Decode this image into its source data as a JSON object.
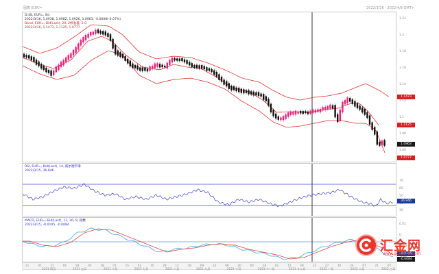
{
  "titlebar": {
    "left": "图表 EUR/=",
    "right": "2022/3/16 · 2022/4/8 GMT+"
  },
  "price": {
    "info1": "D:48, EUR=, Bd",
    "info2": "2022/3/16, 1.0938, 1.0982, 1.0926, 1.0963, -0.0008(-0.07%)",
    "info3": "Band, EUR=, Bid(Last), 20, 2标准差, 2.0",
    "info4": "2022/3/16, 1.1473, 1.1125, 1.0777",
    "y_ticks": [
      "1.22",
      "1.2",
      "1.18",
      "1.16",
      "1.14",
      "1.12",
      "1.1",
      "1.08",
      "1.06"
    ],
    "tags": {
      "upper": "1.1473",
      "mid": "1.1125",
      "last": "1.0963",
      "lower": "1.0777"
    },
    "colors": {
      "up": "#e8207a",
      "down": "#111111",
      "band": "#e03030",
      "cursor": "#333333"
    }
  },
  "rsi": {
    "info1": "RSI, EUR=, Bid(Last), 14, 威尔德平滑",
    "info2": "2022/3/15, 36.946",
    "y_ticks": [
      "70",
      "60",
      "50",
      "40",
      "30"
    ],
    "tag": "36.946",
    "color": "#3a3ac8"
  },
  "macd": {
    "info1": "MACD, EUR=, Bid(Last), 12, 26, 9, 指数",
    "info2": "2022/3/15, -0.0105, -0.0084",
    "y_ticks": [
      "0.01",
      "0",
      "-0.01",
      "-0.02"
    ],
    "tags": {
      "macd": "-0.0105",
      "signal": "-0.0084"
    },
    "colors": {
      "macd": "#e04040",
      "signal": "#40a0e0"
    }
  },
  "xaxis": {
    "days": [
      "21",
      "07",
      "21",
      "04",
      "18",
      "04",
      "18",
      "01",
      "15",
      "01",
      "15",
      "29",
      "12",
      "26",
      "09",
      "23",
      "06",
      "20",
      "04",
      "18",
      "01",
      "15",
      "29",
      "13",
      "27",
      "10",
      "24",
      "07",
      "21",
      "07"
    ],
    "months": [
      "2021 四月",
      "2021 五月",
      "2021 六月",
      "2021 七月",
      "2021 八月",
      "2021 九月",
      "2021 十月",
      "2021 十一月",
      "2021 十二月",
      "2022 一月",
      "2022 二月",
      "2022 三月"
    ]
  },
  "watermark": {
    "brand": "汇金网",
    "url": "www.gold678.com"
  }
}
